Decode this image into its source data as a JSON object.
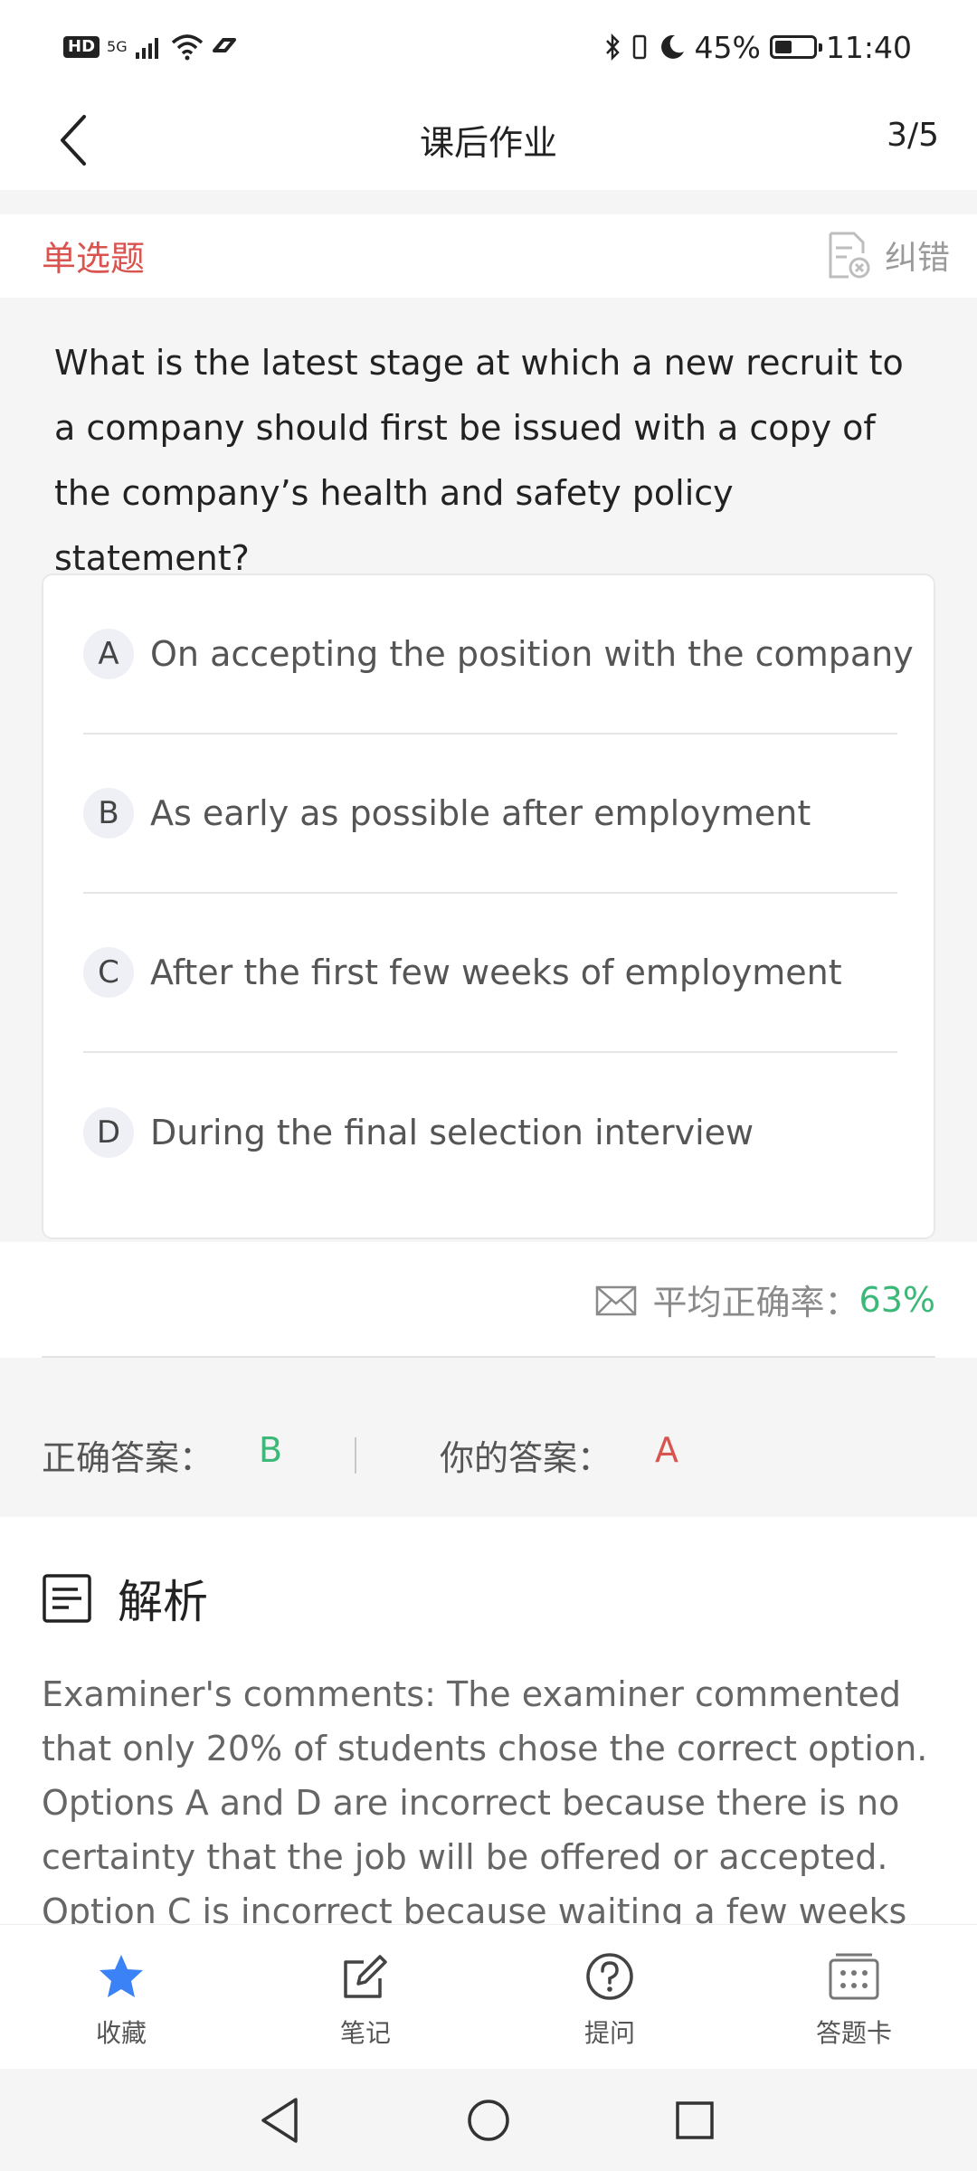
{
  "status_bar": {
    "hd": "HD",
    "network": "5G",
    "battery_percent": "45%",
    "battery_level": 0.45,
    "time": "11:40"
  },
  "header": {
    "title": "课后作业",
    "counter": "3/5"
  },
  "question_type": "单选题",
  "report_label": "纠错",
  "question": "What is the latest stage at which a new recruit to a company should first be issued with a copy of the company’s health and safety policy statement?",
  "options": [
    {
      "letter": "A",
      "text": "On accepting the position with the company"
    },
    {
      "letter": "B",
      "text": "As early as possible after employment"
    },
    {
      "letter": "C",
      "text": "After the first few weeks of employment"
    },
    {
      "letter": "D",
      "text": "During the final selection interview"
    }
  ],
  "accuracy": {
    "label": "平均正确率：",
    "value": "63%"
  },
  "answers": {
    "correct_label": "正确答案：",
    "correct_value": "B",
    "yours_label": "你的答案：",
    "yours_value": "A"
  },
  "analysis": {
    "title": "解析",
    "body": "Examiner's comments: The examiner commented that only 20% of students chose the correct option. Options A and D are incorrect because there is no certainty that the job will be offered or accepted. Option C is incorrect because waiting a few weeks"
  },
  "toolbar": [
    {
      "label": "收藏",
      "icon": "star-icon"
    },
    {
      "label": "笔记",
      "icon": "edit-note-icon"
    },
    {
      "label": "提问",
      "icon": "question-icon"
    },
    {
      "label": "答题卡",
      "icon": "answer-card-icon"
    }
  ],
  "colors": {
    "red": "#d9534f",
    "green": "#3cb878",
    "blue_star": "#3b82f6"
  }
}
